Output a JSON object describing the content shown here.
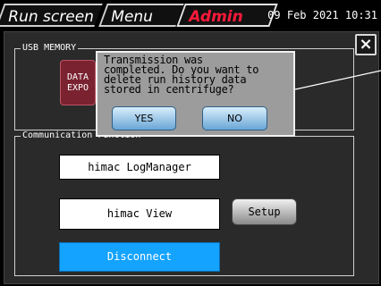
{
  "tabs": {
    "run_screen": "Run screen",
    "menu": "Menu",
    "admin": "Admin"
  },
  "datetime": "09 Feb 2021 10:31",
  "close_icon": "×",
  "usb_memory": {
    "legend": "USB MEMORY",
    "data_export_line1": "DATA",
    "data_export_line2": "EXPO"
  },
  "communication": {
    "legend": "Communication Function",
    "logmanager": "himac LogManager",
    "view": "himac View",
    "setup": "Setup",
    "disconnect": "Disconnect"
  },
  "dialog": {
    "message": "Transmission was\ncompleted. Do you want to\ndelete run history data\nstored in centrifuge?",
    "yes": "YES",
    "no": "NO"
  },
  "colors": {
    "admin_tab": "#ff1a3a",
    "disconnect_bg": "#14a3ff",
    "dialog_bg": "#9c9c9c"
  }
}
